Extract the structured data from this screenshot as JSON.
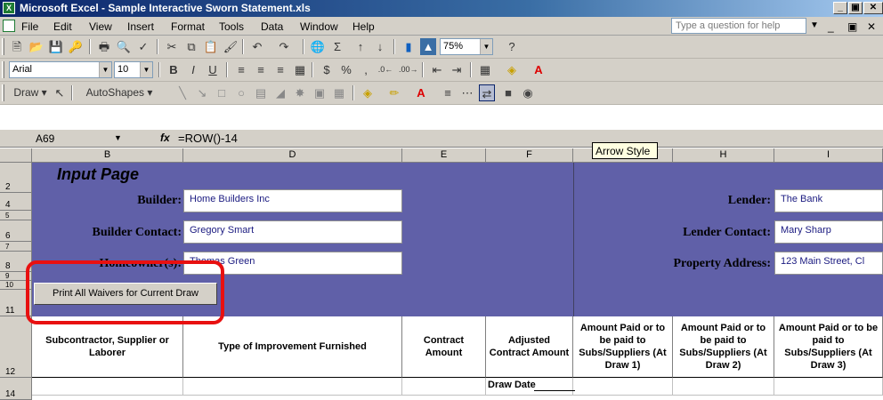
{
  "window": {
    "title": "Microsoft Excel - Sample Interactive Sworn Statement.xls",
    "app_icon": "excel-icon",
    "controls": [
      "_",
      "̵̵",
      "X"
    ]
  },
  "menu": {
    "items": [
      "File",
      "Edit",
      "View",
      "Insert",
      "Format",
      "Tools",
      "Data",
      "Window",
      "Help"
    ],
    "help_placeholder": "Type a question for help"
  },
  "standard_toolbar": {
    "zoom": "75%"
  },
  "format_toolbar": {
    "font": "Arial",
    "size": "10"
  },
  "drawing_toolbar": {
    "draw_label": "Draw",
    "autoshapes_label": "AutoShapes"
  },
  "formula_bar": {
    "name_box": "A69",
    "fx": "fx",
    "formula": "=ROW()-14"
  },
  "tooltip": "Arrow Style",
  "columns": [
    "B",
    "D",
    "E",
    "F",
    "G",
    "H",
    "I"
  ],
  "rows": [
    "2",
    "4",
    "5",
    "6",
    "7",
    "8",
    "9",
    "10",
    "11",
    "12",
    "14"
  ],
  "sheet": {
    "page_title": "Input Page",
    "builder_label": "Builder:",
    "builder_value": "Home Builders Inc",
    "builder_contact_label": "Builder Contact:",
    "builder_contact_value": "Gregory Smart",
    "homeowner_label": "Homeowner(s):",
    "homeowner_value": "Thomas Green",
    "lender_label": "Lender:",
    "lender_value": "The Bank",
    "lender_contact_label": "Lender Contact:",
    "lender_contact_value": "Mary Sharp",
    "property_label": "Property Address:",
    "property_value": "123 Main Street, Cl",
    "print_button": "Print All Waivers for Current Draw",
    "headers": [
      "Subcontractor, Supplier or Laborer",
      "Type of Improvement Furnished",
      "Contract Amount",
      "Adjusted Contract Amount",
      "Amount Paid or to be paid to Subs/Suppliers (At Draw 1)",
      "Amount Paid or to be paid to Subs/Suppliers (At Draw 2)",
      "Amount Paid or to be paid to Subs/Suppliers (At Draw 3)"
    ],
    "draw_date": "Draw Date"
  },
  "colors": {
    "sheet_bg": "#6060a8",
    "highlight": "#e81010",
    "title_bar": "#0a246a"
  }
}
